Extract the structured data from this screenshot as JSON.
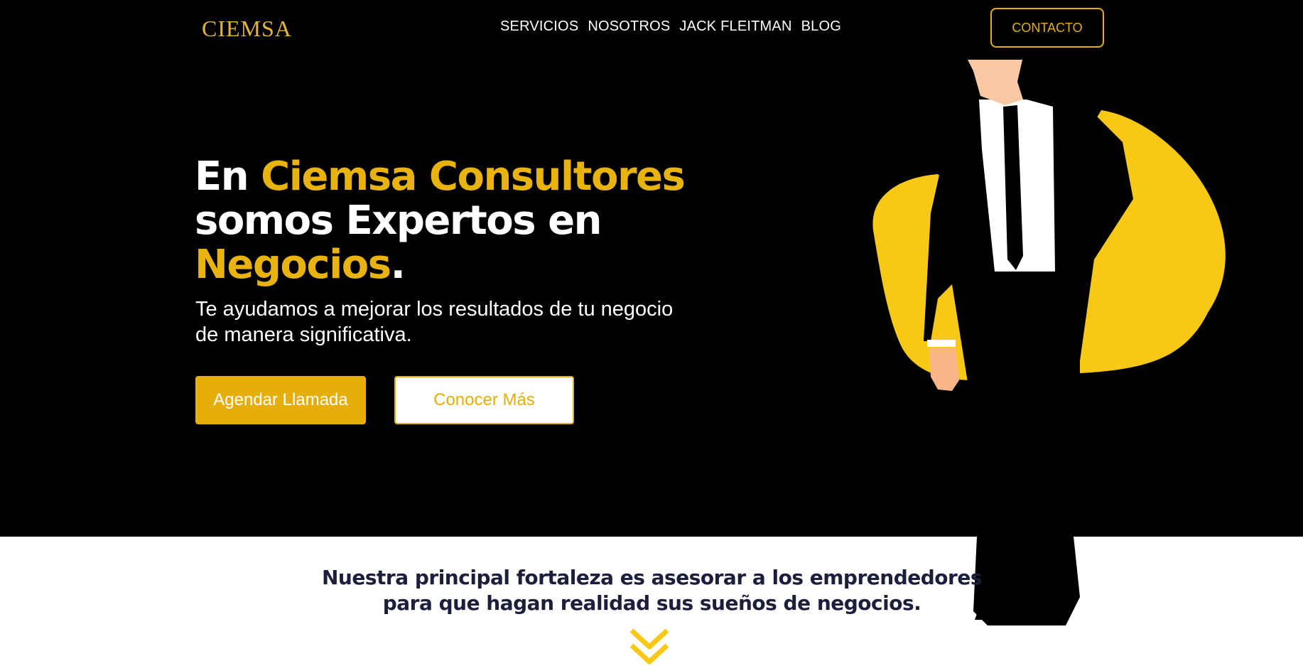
{
  "header": {
    "logo": "CIEMSA",
    "nav": [
      {
        "label": "SERVICIOS"
      },
      {
        "label": "NOSOTROS"
      },
      {
        "label": "JACK FLEITMAN"
      },
      {
        "label": "BLOG"
      }
    ],
    "contact_label": "CONTACTO"
  },
  "hero": {
    "headline_part1": "En ",
    "headline_highlight1": "Ciemsa Consultores",
    "headline_part2": "somos Expertos en",
    "headline_highlight2": "Negocios",
    "headline_end": ".",
    "subtitle_line1": "Te ayudamos a mejorar los resultados de tu negocio",
    "subtitle_line2": "de manera significativa.",
    "primary_button": "Agendar Llamada",
    "secondary_button": "Conocer Más",
    "illustration_icon": "businessman-illustration"
  },
  "mission": {
    "line1": "Nuestra principal fortaleza es asesorar a los emprendedores",
    "line2": "para que hagan realidad sus sueños de negocios.",
    "scroll_icon": "double-chevron-down-icon"
  },
  "colors": {
    "accent": "#e8b20f",
    "hero_background": "#000000",
    "text_dark": "#1b1f3b"
  }
}
